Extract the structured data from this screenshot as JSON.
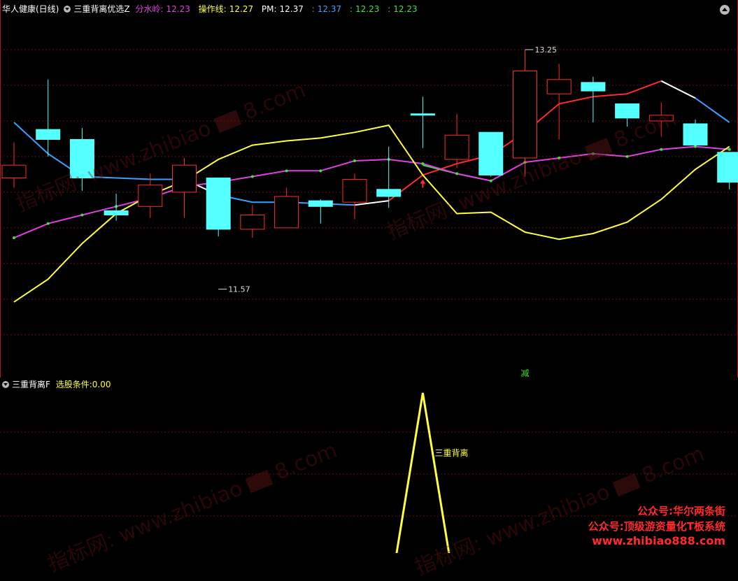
{
  "main_header": {
    "stock": "华人健康(日线)",
    "indicator": "三重背离优选Z",
    "items": [
      {
        "label": "分水岭:",
        "value": "12.23",
        "color": "#e040e0"
      },
      {
        "label": "操作线:",
        "value": "12.27",
        "color": "#ffff40"
      },
      {
        "label": "PM:",
        "value": "12.37",
        "color": "#ffffff"
      },
      {
        "label": ":",
        "value": "12.37",
        "color": "#3aa0ff"
      },
      {
        "label": ":",
        "value": "12.23",
        "color": "#40e040"
      },
      {
        "label": ":",
        "value": "12.23",
        "color": "#40e040"
      }
    ]
  },
  "sub_header": {
    "indicator": "三重背离F",
    "label": "选股条件:",
    "value": "0.00"
  },
  "watermarks": [
    "指标网: www.zhibiao",
    "8.com"
  ],
  "promo": [
    "公众号:华尔两条街",
    "公众号:顶级游资量化T板系统",
    "www.zhibiao888.com"
  ],
  "chart_data": [
    {
      "type": "candlestick",
      "pane": "main",
      "ylim": [
        10.95,
        13.5
      ],
      "annotations": [
        {
          "text": "13.25",
          "x": 15,
          "y": 13.25
        },
        {
          "text": "11.57",
          "x": 6,
          "y": 11.57
        },
        {
          "text": "减",
          "x": 15
        }
      ],
      "candles": [
        {
          "open": 12.35,
          "close": 12.44,
          "high": 12.6,
          "low": 12.28,
          "color": "red"
        },
        {
          "open": 12.69,
          "close": 12.62,
          "high": 13.04,
          "low": 12.5,
          "color": "cyan"
        },
        {
          "open": 12.62,
          "close": 12.35,
          "high": 12.7,
          "low": 12.26,
          "color": "cyan"
        },
        {
          "open": 12.12,
          "close": 12.09,
          "high": 12.24,
          "low": 12.05,
          "color": "cyan"
        },
        {
          "open": 12.15,
          "close": 12.3,
          "high": 12.38,
          "low": 12.07,
          "color": "red"
        },
        {
          "open": 12.25,
          "close": 12.44,
          "high": 12.49,
          "low": 12.07,
          "color": "red"
        },
        {
          "open": 12.35,
          "close": 11.99,
          "high": 12.35,
          "low": 11.94,
          "color": "cyan"
        },
        {
          "open": 11.99,
          "close": 12.09,
          "high": 12.16,
          "low": 11.93,
          "color": "red"
        },
        {
          "open": 12.0,
          "close": 12.22,
          "high": 12.28,
          "low": 12.0,
          "color": "red"
        },
        {
          "open": 12.15,
          "close": 12.19,
          "high": 12.2,
          "low": 12.03,
          "color": "cyan"
        },
        {
          "open": 12.18,
          "close": 12.34,
          "high": 12.38,
          "low": 12.06,
          "color": "red"
        },
        {
          "open": 12.27,
          "close": 12.22,
          "high": 12.57,
          "low": 12.14,
          "color": "cyan"
        },
        {
          "open": 12.8,
          "close": 12.8,
          "high": 12.92,
          "low": 12.56,
          "color": "cyan"
        },
        {
          "open": 12.48,
          "close": 12.65,
          "high": 12.8,
          "low": 12.42,
          "color": "red"
        },
        {
          "open": 12.67,
          "close": 12.37,
          "high": 12.67,
          "low": 12.36,
          "color": "cyan"
        },
        {
          "open": 12.49,
          "close": 13.1,
          "high": 13.25,
          "low": 12.36,
          "color": "red"
        },
        {
          "open": 12.94,
          "close": 13.04,
          "high": 13.15,
          "low": 12.62,
          "color": "red"
        },
        {
          "open": 13.02,
          "close": 12.96,
          "high": 13.06,
          "low": 12.74,
          "color": "cyan"
        },
        {
          "open": 12.87,
          "close": 12.77,
          "high": 12.87,
          "low": 12.71,
          "color": "cyan"
        },
        {
          "open": 12.75,
          "close": 12.79,
          "high": 12.88,
          "low": 12.64,
          "color": "red"
        },
        {
          "open": 12.73,
          "close": 12.58,
          "high": 12.76,
          "low": 12.57,
          "color": "cyan"
        },
        {
          "open": 12.53,
          "close": 12.32,
          "high": 12.53,
          "low": 12.27,
          "color": "cyan"
        }
      ],
      "lines": [
        {
          "name": "pm",
          "segments": [
            {
              "color": "#3aa0ff",
              "points": [
                [
                  0,
                  12.74
                ],
                [
                  1,
                  12.52
                ],
                [
                  2,
                  12.36
                ],
                [
                  3,
                  12.35
                ],
                [
                  4,
                  12.34
                ],
                [
                  5,
                  12.34
                ]
              ]
            },
            {
              "color": "#ffffff",
              "points": [
                [
                  5,
                  12.34
                ],
                [
                  6,
                  12.23
                ]
              ]
            },
            {
              "color": "#3aa0ff",
              "points": [
                [
                  6,
                  12.23
                ],
                [
                  7,
                  12.18
                ],
                [
                  8,
                  12.18
                ],
                [
                  9,
                  12.17
                ],
                [
                  10,
                  12.16
                ]
              ]
            },
            {
              "color": "#ffffff",
              "points": [
                [
                  10,
                  12.16
                ],
                [
                  11,
                  12.19
                ]
              ]
            },
            {
              "color": "#ff2a2a",
              "points": [
                [
                  11,
                  12.19
                ],
                [
                  12,
                  12.37
                ],
                [
                  13,
                  12.45
                ],
                [
                  14,
                  12.51
                ],
                [
                  15,
                  12.67
                ],
                [
                  16,
                  12.87
                ],
                [
                  17,
                  12.92
                ],
                [
                  18,
                  12.94
                ],
                [
                  19,
                  13.03
                ]
              ]
            },
            {
              "color": "#40e040",
              "points": [
                [
                  12,
                  12.44
                ],
                [
                  13,
                  12.38
                ],
                [
                  14,
                  12.33
                ]
              ]
            },
            {
              "color": "#ffffff",
              "points": [
                [
                  19,
                  13.03
                ],
                [
                  20,
                  12.91
                ]
              ]
            },
            {
              "color": "#3aa0ff",
              "points": [
                [
                  20,
                  12.91
                ],
                [
                  21,
                  12.74
                ]
              ]
            }
          ]
        },
        {
          "name": "分水岭",
          "color": "#e040e0",
          "points": [
            [
              0,
              11.93
            ],
            [
              1,
              12.03
            ],
            [
              2,
              12.09
            ],
            [
              3,
              12.15
            ],
            [
              4,
              12.21
            ],
            [
              5,
              12.29
            ],
            [
              6,
              12.32
            ],
            [
              7,
              12.36
            ],
            [
              8,
              12.4
            ],
            [
              9,
              12.4
            ],
            [
              10,
              12.47
            ],
            [
              11,
              12.48
            ],
            [
              12,
              12.45
            ],
            [
              13,
              12.38
            ],
            [
              14,
              12.33
            ],
            [
              15,
              12.46
            ],
            [
              16,
              12.49
            ],
            [
              17,
              12.52
            ],
            [
              18,
              12.5
            ],
            [
              19,
              12.55
            ],
            [
              20,
              12.57
            ],
            [
              21,
              12.55
            ]
          ]
        },
        {
          "name": "操作线",
          "color": "#ffff40",
          "points": [
            [
              0,
              11.48
            ],
            [
              1,
              11.64
            ],
            [
              2,
              11.89
            ],
            [
              3,
              12.1
            ],
            [
              4,
              12.23
            ],
            [
              5,
              12.33
            ],
            [
              6,
              12.48
            ],
            [
              7,
              12.58
            ],
            [
              8,
              12.61
            ],
            [
              9,
              12.63
            ],
            [
              10,
              12.67
            ],
            [
              11,
              12.72
            ],
            [
              12,
              12.37
            ],
            [
              13,
              12.1
            ],
            [
              14,
              12.11
            ],
            [
              15,
              11.97
            ],
            [
              16,
              11.92
            ],
            [
              17,
              11.96
            ],
            [
              18,
              12.04
            ],
            [
              19,
              12.2
            ],
            [
              20,
              12.41
            ],
            [
              21,
              12.57
            ]
          ]
        }
      ],
      "signal": {
        "type": "up-arrow",
        "x": 12,
        "color": "#ff2a2a"
      }
    },
    {
      "type": "line",
      "pane": "sub",
      "series": [
        {
          "name": "",
          "color": "#ffff40",
          "points": [
            [
              11.0,
              0
            ],
            [
              12.0,
              1
            ],
            [
              13.0,
              0
            ]
          ]
        }
      ],
      "label": {
        "text": "三重背离",
        "x": 12.35
      }
    }
  ]
}
